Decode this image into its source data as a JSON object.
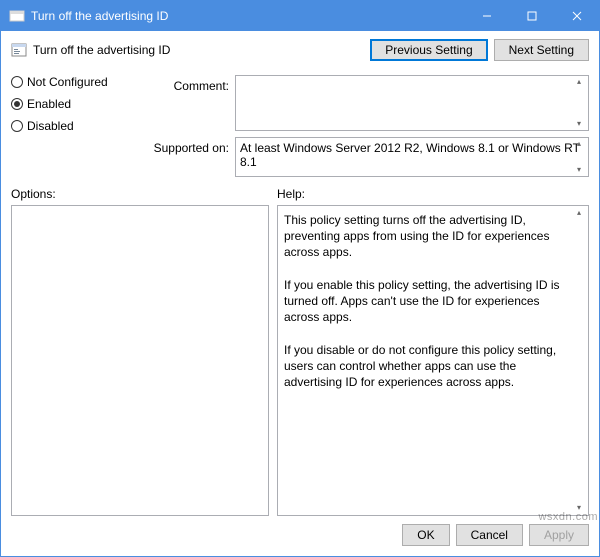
{
  "titlebar": {
    "title": "Turn off the advertising ID"
  },
  "header": {
    "title": "Turn off the advertising ID",
    "previous_label": "Previous Setting",
    "next_label": "Next Setting"
  },
  "radio": {
    "not_configured": "Not Configured",
    "enabled": "Enabled",
    "disabled": "Disabled",
    "selected": "enabled"
  },
  "fields": {
    "comment_label": "Comment:",
    "comment_value": "",
    "supported_label": "Supported on:",
    "supported_value": "At least Windows Server 2012 R2, Windows 8.1 or Windows RT 8.1"
  },
  "lower": {
    "options_label": "Options:",
    "options_value": "",
    "help_label": "Help:",
    "help_value": "This policy setting turns off the advertising ID, preventing apps from using the ID for experiences across apps.\n\nIf you enable this policy setting, the advertising ID is turned off. Apps can't use the ID for experiences across apps.\n\nIf you disable or do not configure this policy setting, users can control whether apps can use the advertising ID for experiences across apps."
  },
  "buttons": {
    "ok": "OK",
    "cancel": "Cancel",
    "apply": "Apply"
  },
  "watermark": "wsxdn.com"
}
